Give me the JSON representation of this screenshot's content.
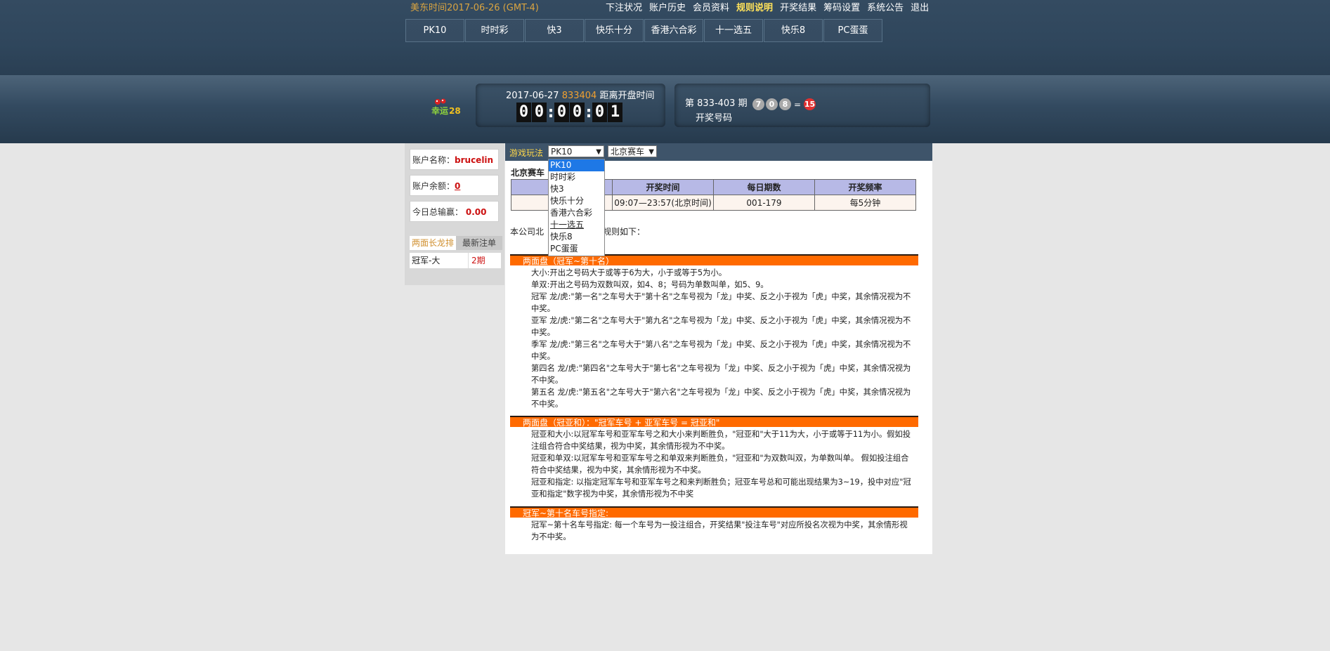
{
  "header": {
    "clock": "美东时间2017-06-26 (GMT-4)",
    "nav": [
      "下注状况",
      "账户历史",
      "会员资料",
      "规则说明",
      "开奖结果",
      "筹码设置",
      "系统公告",
      "退出"
    ],
    "active_nav": "规则说明",
    "game_tabs": [
      "PK10",
      "时时彩",
      "快3",
      "快乐十分",
      "香港六合彩",
      "十一选五",
      "快乐8",
      "PC蛋蛋"
    ]
  },
  "draw": {
    "logo_text": "幸运28",
    "date": "2017-06-27",
    "issue_orange": "833404",
    "countdown_label": "距离开盘时间",
    "countdown_digits": [
      "0",
      "0",
      "0",
      "0",
      "0",
      "1"
    ],
    "issue_label": "第 833-403 期",
    "draw_label": "开奖号码",
    "balls": [
      "7",
      "0",
      "8"
    ],
    "equals": "=",
    "sum": "15"
  },
  "account": {
    "name_label": "账户名称：",
    "name": "brucelin",
    "balance_label": "账户余额：",
    "balance": "0",
    "profit_label": "今日总输赢：",
    "profit": "0.00",
    "tab1": "两面长龙排",
    "tab2": "最新注单",
    "row_c1": "冠军-大",
    "row_c2": "2期"
  },
  "main": {
    "play_label": "游戏玩法",
    "select1": "PK10",
    "select2": "北京赛车",
    "title": "北京赛车",
    "table_headers": [
      "",
      "开奖时间",
      "每日期数",
      "开奖频率"
    ],
    "table_row": [
      "",
      "09:07—23:57(北京时间)",
      "001-179",
      "每5分钟"
    ],
    "intro_left": "本公司北",
    "intro_right": "规则如下：",
    "sections": [
      {
        "head": "两面盘（冠军~第十名）",
        "rules": [
          "大小:开出之号码大于或等于6为大，小于或等于5为小。",
          "单双:开出之号码为双数叫双，如4、8；号码为单数叫单，如5、9。",
          "冠军 龙/虎:\"第一名\"之车号大于\"第十名\"之车号视为「龙」中奖、反之小于视为「虎」中奖，其余情况视为不中奖。",
          "亚军 龙/虎:\"第二名\"之车号大于\"第九名\"之车号视为「龙」中奖、反之小于视为「虎」中奖，其余情况视为不中奖。",
          "季军 龙/虎:\"第三名\"之车号大于\"第八名\"之车号视为「龙」中奖、反之小于视为「虎」中奖，其余情况视为不中奖。",
          "第四名 龙/虎:\"第四名\"之车号大于\"第七名\"之车号视为「龙」中奖、反之小于视为「虎」中奖，其余情况视为不中奖。",
          "第五名 龙/虎:\"第五名\"之车号大于\"第六名\"之车号视为「龙」中奖、反之小于视为「虎」中奖，其余情况视为不中奖。"
        ]
      },
      {
        "head": "两面盘（冠亚和）：\"冠军车号 + 亚军车号 = 冠亚和\"",
        "rules": [
          "冠亚和大小:以冠军车号和亚军车号之和大小来判断胜负，\"冠亚和\"大于11为大，小于或等于11为小。假如投注组合符合中奖结果，视为中奖，其余情形视为不中奖。",
          "冠亚和单双:以冠军车号和亚军车号之和单双来判断胜负，\"冠亚和\"为双数叫双，为单数叫单。 假如投注组合符合中奖结果，视为中奖，其余情形视为不中奖。",
          "冠亚和指定: 以指定冠军车号和亚军车号之和来判断胜负；冠亚车号总和可能出现结果为3~19，投中对应\"冠亚和指定\"数字视为中奖，其余情形视为不中奖"
        ]
      },
      {
        "head": "冠军~第十名车号指定:",
        "rules": [
          "冠军~第十名车号指定: 每一个车号为一投注组合，开奖结果\"投注车号\"对应所投名次视为中奖，其余情形视为不中奖。"
        ]
      }
    ]
  },
  "dropdown": {
    "options": [
      "PK10",
      "时时彩",
      "快3",
      "快乐十分",
      "香港六合彩",
      "十一选五",
      "快乐8",
      "PC蛋蛋"
    ],
    "selected": "PK10",
    "hovered": "十一选五"
  }
}
